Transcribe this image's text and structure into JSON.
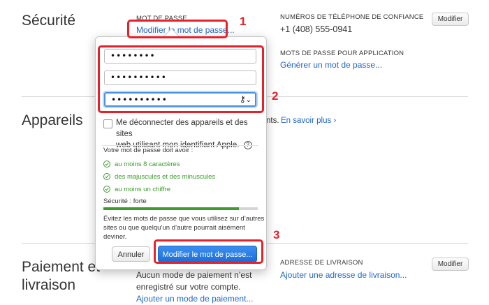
{
  "security": {
    "title": "Sécurité",
    "password_heading": "MOT DE PASSE",
    "change_password_link": "Modifier le mot de passe...",
    "trusted_phones_heading": "NUMÉROS DE TÉLÉPHONE DE CONFIANCE",
    "trusted_phone_number": "+1 (408) 555-0941",
    "modify_button": "Modifier",
    "app_passwords_heading": "MOTS DE PASSE POUR APPLICATION",
    "generate_password_link": "Générer un mot de passe..."
  },
  "devices": {
    "title": "Appareils",
    "tail_text": "nts.",
    "learn_more_link": "En savoir plus",
    "learn_more_chevron": "›"
  },
  "payment": {
    "title_line1": "Paiement et",
    "title_line2": "livraison",
    "no_payment_line1": "Aucun mode de paiement n’est",
    "no_payment_line2": "enregistré sur votre compte.",
    "add_payment_link": "Ajouter un mode de paiement...",
    "shipping_heading": "ADRESSE DE LIVRAISON",
    "add_shipping_link": "Ajouter une adresse de livraison...",
    "modify_button": "Modifier"
  },
  "popover": {
    "current_password": "••••••••",
    "new_password": "••••••••••",
    "confirm_password": "••••••••••",
    "key_icon": "⚷",
    "dropdown_icon": "⌄",
    "signout_line1": "Me déconnecter des appareils et des sites",
    "signout_line2": "web utilisant mon identifiant Apple.",
    "help_icon": "?",
    "requirements_heading": "Votre mot de passe doit avoir :",
    "rules": [
      "au moins 8 caractères",
      "des majuscules et des minuscules",
      "au moins un chiffre"
    ],
    "strength_label": "Sécurité : forte",
    "strength_level": 0.88,
    "advice_line1": "Évitez les mots de passe que vous utilisez sur d’autres",
    "advice_line2": "sites ou que quelqu’un d’autre pourrait aisément",
    "advice_line3": "deviner.",
    "cancel_button": "Annuler",
    "submit_button": "Modifier le mot de passe..."
  },
  "annotations": {
    "step1": "1",
    "step2": "2",
    "step3": "3",
    "highlight_color": "#e8202a"
  },
  "colors": {
    "link": "#2266c5",
    "success": "#3c9b2b",
    "primary_button": "#1a73e0"
  }
}
